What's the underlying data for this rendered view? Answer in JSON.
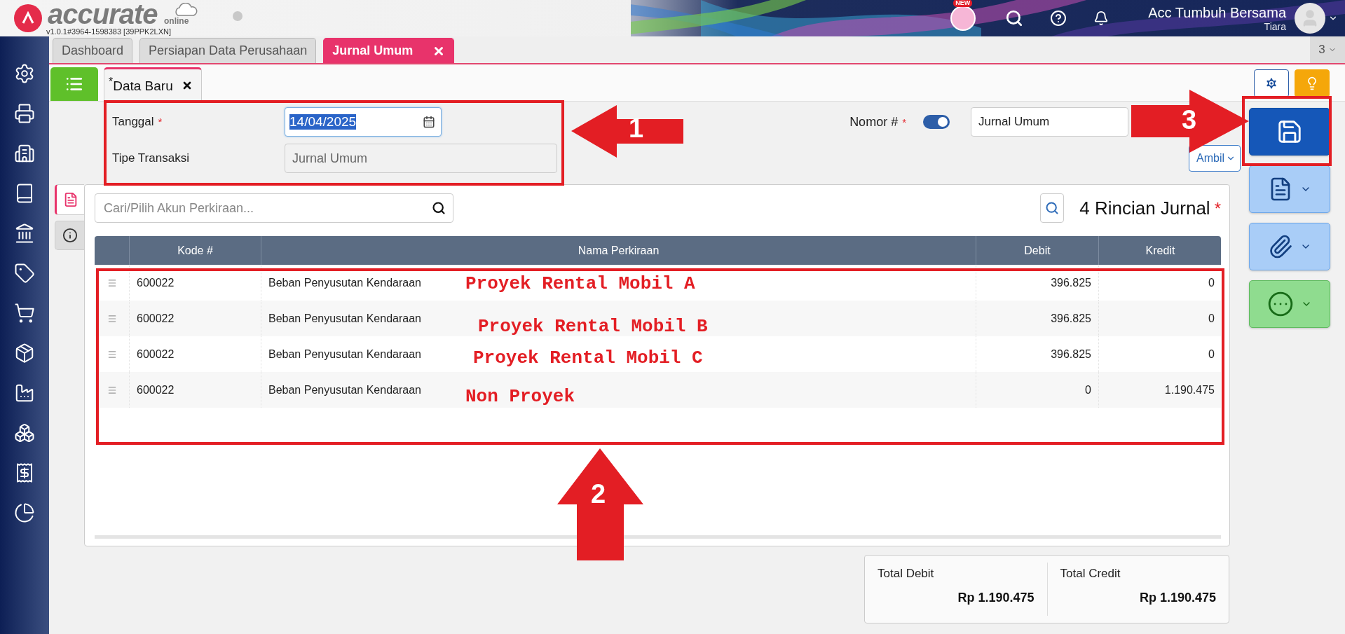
{
  "header": {
    "logo": "accurate",
    "logo_sub": "online",
    "version": "v1.0.1#3964-1598383 [39PPK2LXN]",
    "badge": "NEW",
    "company": "Acc Tumbuh Bersama",
    "user": "Tiara"
  },
  "sidebar": [
    {
      "kind": "settings"
    },
    {
      "kind": "printer"
    },
    {
      "kind": "building"
    },
    {
      "kind": "book"
    },
    {
      "kind": "bank"
    },
    {
      "kind": "tag"
    },
    {
      "kind": "cart"
    },
    {
      "kind": "package"
    },
    {
      "kind": "factory"
    },
    {
      "kind": "boxes"
    },
    {
      "kind": "receipt"
    },
    {
      "kind": "chart"
    }
  ],
  "tabs": [
    {
      "label": "Dashboard",
      "selected": false
    },
    {
      "label": "Persiapan Data Perusahaan",
      "selected": false
    },
    {
      "label": "Jurnal Umum",
      "selected": true
    }
  ],
  "tab_count": "3",
  "doc_tabs": [
    {
      "label": "$^{*}$Data Baru",
      "selected": true
    }
  ],
  "form": {
    "date": {
      "label": "Tanggal",
      "required_mark": "*",
      "value": "14/04/2025",
      "highlighted": true
    },
    "type": {
      "label": "Tipe Transaksi",
      "value": "Jurnal Umum"
    },
    "number": {
      "label": "Nomor #",
      "required_mark": "*",
      "on": true,
      "value": "Jurnal Umum"
    },
    "fetch_button": "Ambil"
  },
  "side_tabs": [
    {
      "kind": "document",
      "selected": true
    },
    {
      "kind": "info",
      "selected": false
    }
  ],
  "details": {
    "search": {
      "placeholder": "Cari/Pilih Akun Perkiraan..."
    },
    "title": "4 Rincian Jurnal",
    "required_mark": "*",
    "columns": [
      "Kode #",
      "Nama Perkiraan",
      "Debit",
      "Kredit"
    ],
    "rows": [
      {
        "code": "600022",
        "name": "Beban Penyusutan Kendaraan",
        "debit": "396.825",
        "credit": "0"
      },
      {
        "code": "600022",
        "name": "Beban Penyusutan Kendaraan",
        "debit": "396.825",
        "credit": "0"
      },
      {
        "code": "600022",
        "name": "Beban Penyusutan Kendaraan",
        "debit": "396.825",
        "credit": "0"
      },
      {
        "code": "600022",
        "name": "Beban Penyusutan Kendaraan",
        "debit": "0",
        "credit": "1.190.475"
      }
    ]
  },
  "totals": [
    {
      "label": "Total Debit",
      "value": "Rp 1.190.475"
    },
    {
      "label": "Total Credit",
      "value": "Rp 1.190.475"
    }
  ],
  "actions": [
    {
      "kind": "save"
    },
    {
      "kind": "document"
    },
    {
      "kind": "attachment"
    },
    {
      "kind": "more"
    }
  ],
  "annotations": {
    "callouts": [
      {
        "number": "1",
        "kind": "left"
      },
      {
        "number": "2",
        "kind": "up"
      },
      {
        "number": "3",
        "kind": "right"
      }
    ],
    "notes": [
      "Proyek Rental Mobil A",
      "Proyek Rental Mobil B",
      "Proyek Rental Mobil C",
      "Non Proyek"
    ]
  }
}
